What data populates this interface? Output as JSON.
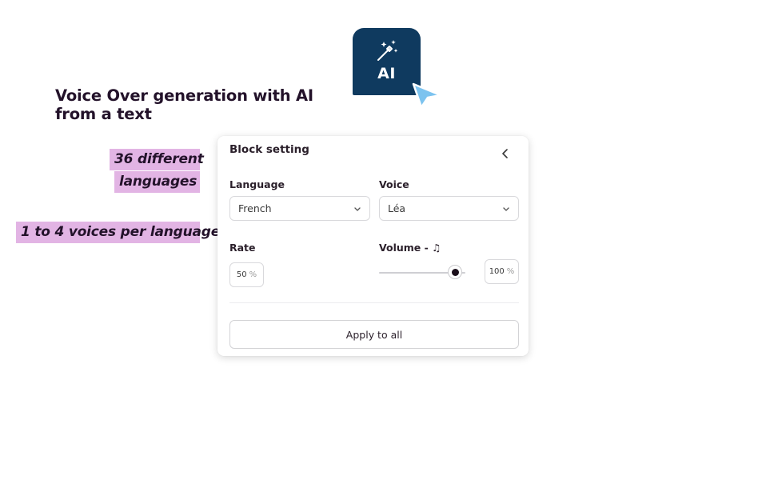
{
  "badge": {
    "text": "AI",
    "icon": "magic-wand-icon",
    "background_color": "#0f3a5f"
  },
  "cursor": {
    "icon": "pointer-cursor-icon",
    "color": "#7cc3ef"
  },
  "headline": {
    "line1": "Voice Over generation with AI",
    "line2": "from a text"
  },
  "highlights": {
    "languages_line1": "36 different",
    "languages_line2": "languages",
    "voices": "1 to 4 voices per language",
    "color": "#e2b4e4"
  },
  "panel": {
    "title": "Block setting",
    "collapse_icon": "chevron-left-icon",
    "language": {
      "label": "Language",
      "value": "French"
    },
    "voice": {
      "label": "Voice",
      "value": "Léa"
    },
    "rate": {
      "label": "Rate",
      "value": "50",
      "unit": "%"
    },
    "volume": {
      "label": "Volume - ♫",
      "value": "100",
      "unit": "%",
      "slider_level_percent": 100
    },
    "apply_label": "Apply to all"
  }
}
